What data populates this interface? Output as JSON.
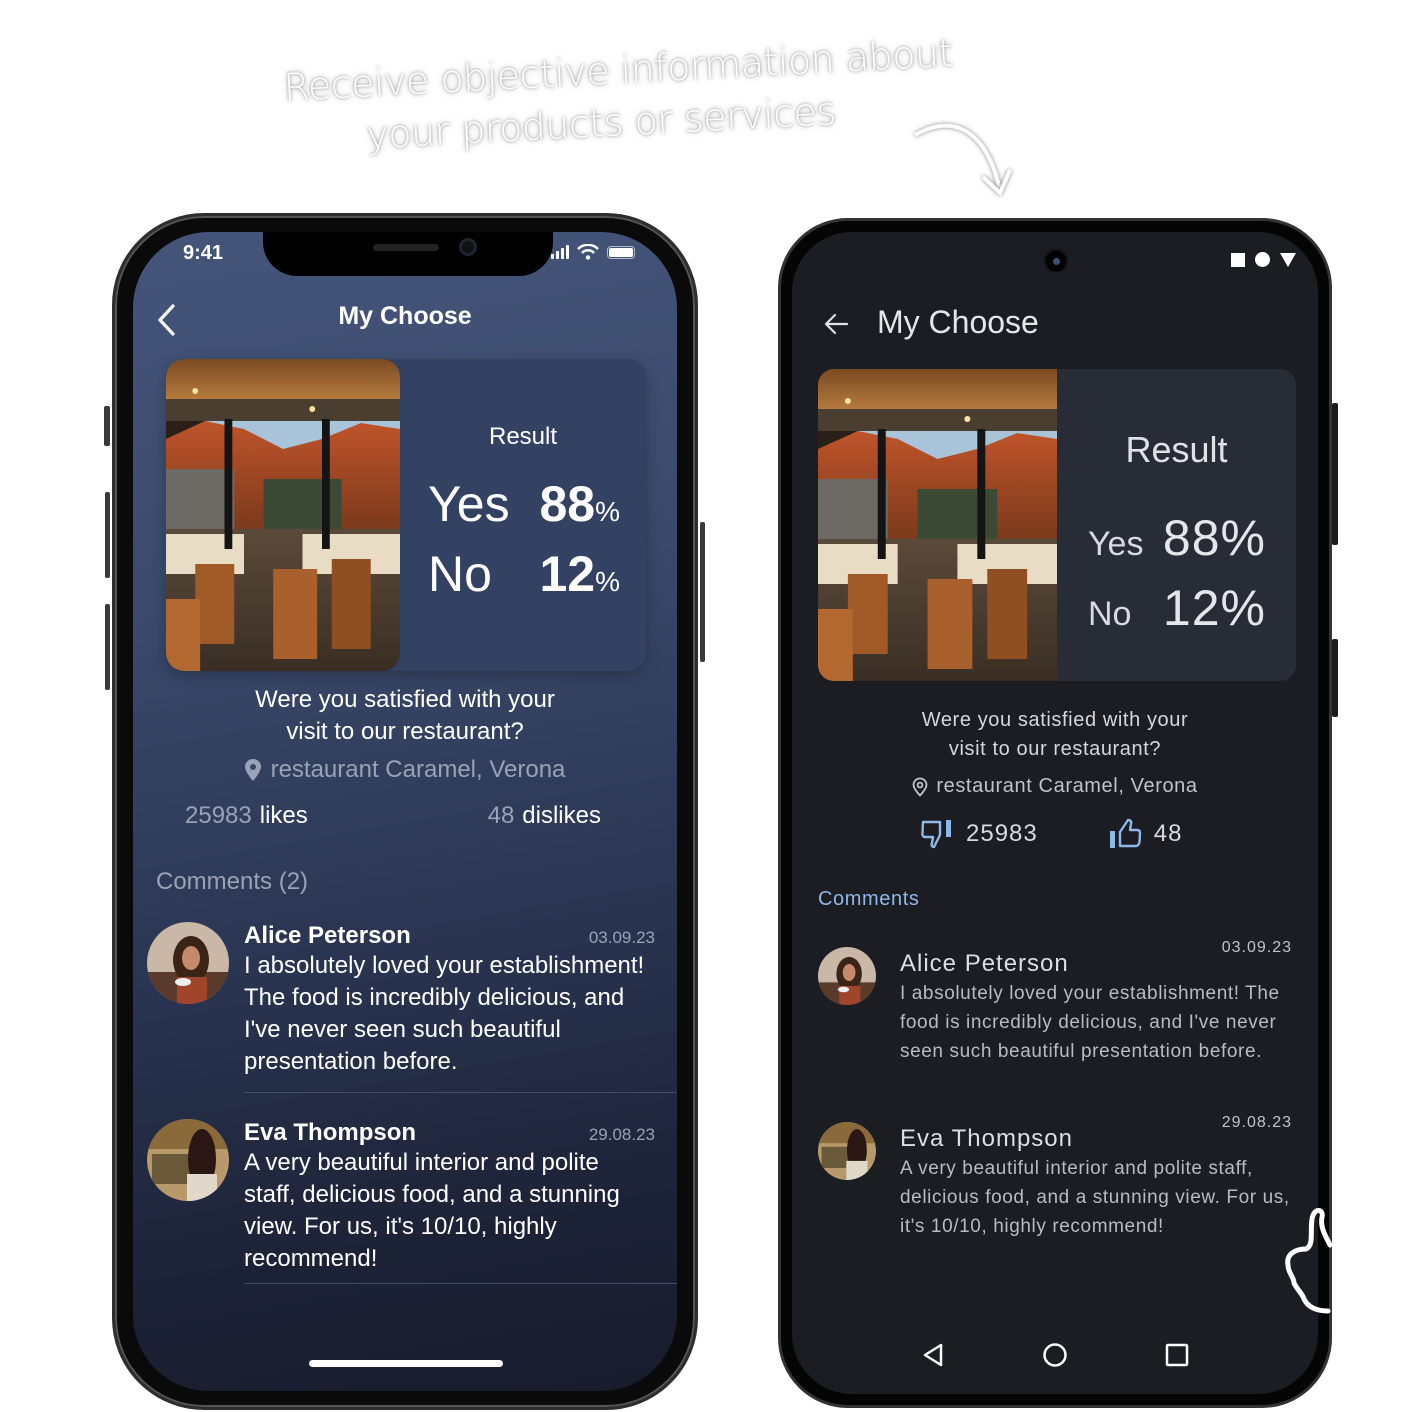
{
  "headline": {
    "line1": "Receive objective information about",
    "line2": "your products or services"
  },
  "icons": {
    "arrow": "curved-arrow-down",
    "hand": "thumbs-up-hand-outline",
    "back": "chevron-left",
    "back_android": "arrow-left",
    "location": "map-pin",
    "like": "thumbs-up",
    "dislike": "thumbs-down"
  },
  "ios": {
    "status": {
      "time": "9:41"
    },
    "title": "My Choose",
    "result": {
      "label": "Result",
      "yes_label": "Yes",
      "yes_value": "88",
      "no_label": "No",
      "no_value": "12",
      "percent_sign": "%"
    },
    "question_line1": "Were you satisfied with your",
    "question_line2": "visit to our restaurant?",
    "location": "restaurant Caramel, Verona",
    "likes_count": "25983",
    "likes_label": "likes",
    "dislikes_count": "48",
    "dislikes_label": "dislikes",
    "comments_heading": "Comments (2)",
    "comments": [
      {
        "name": "Alice Peterson",
        "date": "03.09.23",
        "text": "I absolutely loved your establishment! The food is incredibly delicious, and I've never seen such beautiful presentation before."
      },
      {
        "name": "Eva Thompson",
        "date": "29.08.23",
        "text": "A very beautiful interior and polite staff, delicious food, and a stunning view. For us, it's 10/10, highly recommend!"
      }
    ]
  },
  "android": {
    "title": "My Choose",
    "result": {
      "label": "Result",
      "yes_label": "Yes",
      "yes_value": "88%",
      "no_label": "No",
      "no_value": "12%"
    },
    "question_line1": "Were you satisfied with your",
    "question_line2": "visit to our restaurant?",
    "location": "restaurant Caramel, Verona",
    "dislike_count": "25983",
    "like_count": "48",
    "comments_heading": "Comments",
    "accent_color": "#8fb8ea",
    "comments": [
      {
        "name": "Alice Peterson",
        "date": "03.09.23",
        "text": "I absolutely loved your establishment! The food is incredibly delicious, and I've never seen such beautiful presentation before."
      },
      {
        "name": "Eva Thompson",
        "date": "29.08.23",
        "text": "A very beautiful interior and polite staff, delicious food, and a stunning view. For us, it's 10/10, highly recommend!"
      }
    ]
  }
}
